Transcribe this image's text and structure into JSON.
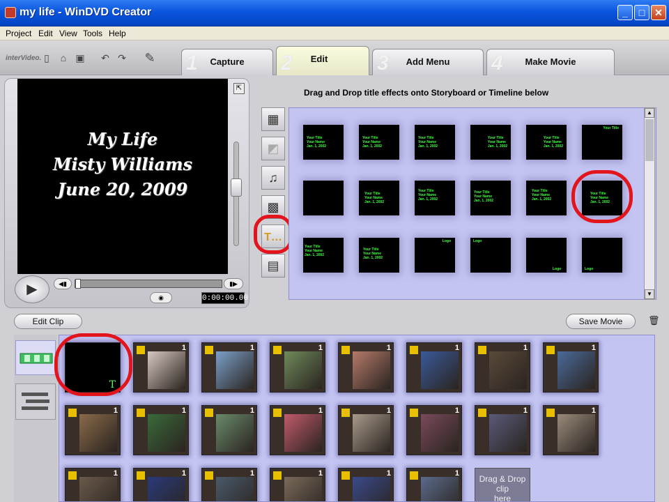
{
  "window": {
    "title": "my life - WinDVD Creator",
    "controls": [
      "_",
      "□",
      "✕"
    ]
  },
  "menu": [
    "Project",
    "Edit",
    "View",
    "Tools",
    "Help"
  ],
  "toolbar": {
    "logo": "interVideo."
  },
  "tabs": [
    {
      "num": "1",
      "label": "Capture"
    },
    {
      "num": "2",
      "label": "Edit"
    },
    {
      "num": "3",
      "label": "Add Menu"
    },
    {
      "num": "4",
      "label": "Make Movie"
    }
  ],
  "preview": {
    "lines": [
      "My Life",
      "Misty Williams",
      "June 20, 2009"
    ],
    "timecode": "0:00:00.00"
  },
  "library": {
    "caption": "Drag and Drop title effects onto Storyboard or Timeline below",
    "effects": [
      "Your Title\nYour Name\nJan. 1, 2002",
      "Your Title\nYour Name\nJan. 1, 2002",
      "Your Title\nYour Name\nJan. 1, 2002",
      "Your Title\nYour Name\nJan. 1, 2002",
      "Your Title\nYour Name\nJan. 1, 2002",
      "Your Title",
      "",
      "Your Title\nYour Name\nJan. 1, 2002",
      "Your Title\nYour Name\nJan. 1, 2002",
      "Your Title\nYour Name\nJan. 1, 2002",
      "Your Title\nYour Name\nJan. 1, 2002",
      "Your Title\nYour Name\nJan. 1, 2002",
      "Your Title\nYour Name\nJan. 1, 2002",
      "Your Title\nYour Name\nJan. 1, 2002",
      "Logo",
      "Logo",
      "Logo",
      "Logo"
    ]
  },
  "storyboard": {
    "edit_clip_label": "Edit Clip",
    "save_movie_label": "Save Movie",
    "title_clip_mark": "T",
    "clip_number": "1",
    "drop_label": [
      "Drag & Drop",
      "clip",
      "here"
    ]
  },
  "colors": {
    "accent": "#e2141c",
    "library_bg": "#c4c4f2",
    "effect_text": "#3fff3f"
  }
}
